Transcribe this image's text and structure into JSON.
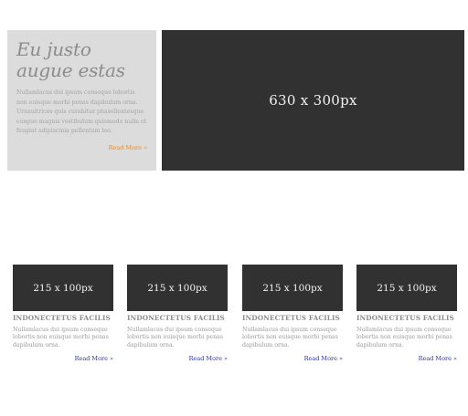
{
  "hero": {
    "title": "Eu justo augue estas",
    "body": "Nullamlacus dui ipsum conseque lobortis non euisque morbi penas dapibulum orna. Urnaultrices quis curabitur phasellentesque congue magnis vestibulum quismodo nulla et feugiat adipiscinia pellentum leo.",
    "read_more": "Read More »",
    "image_label": "630 x 300px",
    "accent_color": "#ee8a1e"
  },
  "cards": [
    {
      "image_label": "215 x 100px",
      "title": "INDONECTETUS FACILIS",
      "body": "Nullamlacus dui ipsum conseque lobortis non euisque morbi penas dapibulum orna.",
      "read_more": "Read More »"
    },
    {
      "image_label": "215 x 100px",
      "title": "INDONECTETUS FACILIS",
      "body": "Nullamlacus dui ipsum conseque lobortis non euisque morbi penas dapibulum orna.",
      "read_more": "Read More »"
    },
    {
      "image_label": "215 x 100px",
      "title": "INDONECTETUS FACILIS",
      "body": "Nullamlacus dui ipsum conseque lobortis non euisque morbi penas dapibulum orna.",
      "read_more": "Read More »"
    },
    {
      "image_label": "215 x 100px",
      "title": "INDONECTETUS FACILIS",
      "body": "Nullamlacus dui ipsum conseque lobortis non euisque morbi penas dapibulum orna.",
      "read_more": "Read More »"
    }
  ],
  "link_color": "#2f2f8f"
}
